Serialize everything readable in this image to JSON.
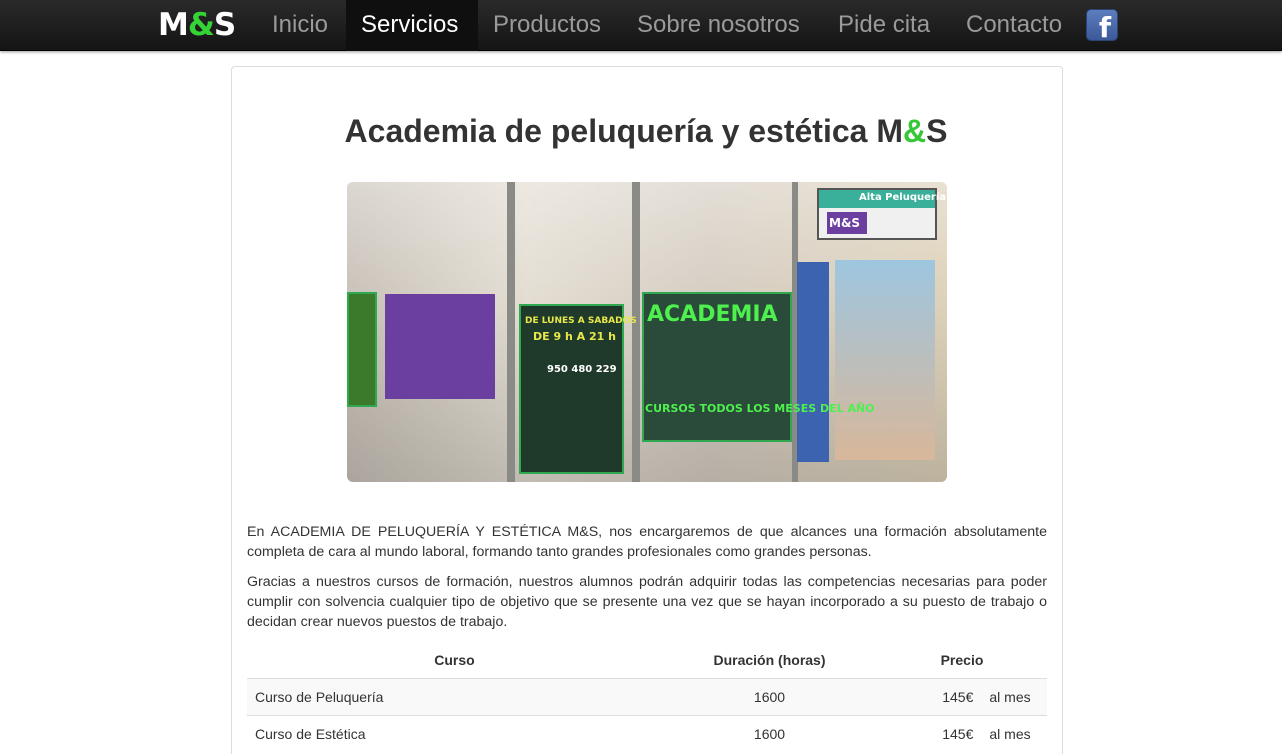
{
  "nav": {
    "logo": {
      "part1": "M",
      "amp": "&",
      "part2": "S"
    },
    "items": [
      "Inicio",
      "Servicios",
      "Productos",
      "Sobre nosotros",
      "Pide cita",
      "Contacto"
    ],
    "active": "Servicios",
    "social_icon": "facebook-icon",
    "social_glyph": "f"
  },
  "colors": {
    "navbar": "#1c1c1c",
    "accent_green": "#35c735",
    "facebook_blue": "#3b5998"
  },
  "main": {
    "title": {
      "prefix": "Academia de peluquería y estética M",
      "amp": "&",
      "suffix": "S"
    },
    "hero_text": {
      "academia": "ACADEMIA",
      "schedule": "DE LUNES A SABADOS",
      "hours": "DE 9 h A 21 h",
      "phone": "950 480 229",
      "sign_top": "Alta Peluquería",
      "sign_logo": "M&S",
      "courses": "CURSOS TODOS LOS MESES DEL AÑO"
    },
    "paragraphs": [
      "En ACADEMIA DE PELUQUERÍA Y ESTÉTICA M&S, nos encargaremos de que alcances una formación absolutamente completa de cara al mundo laboral, formando tanto grandes profesionales como grandes personas.",
      "Gracias a nuestros cursos de formación, nuestros alumnos podrán adquirir todas las competencias necesarias para poder cumplir con solvencia cualquier tipo de objetivo que se presente una vez que se hayan incorporado a su puesto de trabajo o decidan crear nuevos puestos de trabajo."
    ],
    "table": {
      "headers": [
        "Curso",
        "Duración (horas)",
        "Precio"
      ],
      "rows": [
        {
          "curso": "Curso de Peluquería",
          "duracion": "1600",
          "precio": "145€",
          "unidad": "al mes"
        },
        {
          "curso": "Curso de Estética",
          "duracion": "1600",
          "precio": "145€",
          "unidad": "al mes"
        }
      ]
    }
  }
}
